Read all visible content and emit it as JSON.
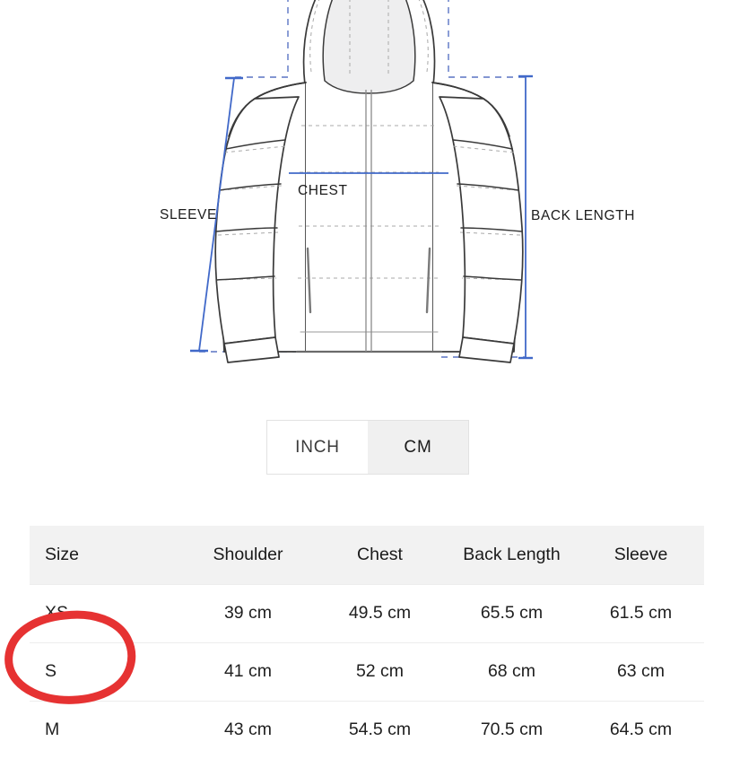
{
  "diagram": {
    "labels": {
      "sleeve": "SLEEVE",
      "chest": "CHEST",
      "back_length": "BACK LENGTH"
    },
    "colors": {
      "measurement_line": "#4169c9",
      "guide_line": "#5a74c4",
      "outline": "#3a3a3a",
      "hood_fill": "#eeeeef"
    }
  },
  "unit_toggle": {
    "options": [
      {
        "label": "INCH",
        "selected": false
      },
      {
        "label": "CM",
        "selected": true
      }
    ]
  },
  "size_table": {
    "columns": [
      "Size",
      "Shoulder",
      "Chest",
      "Back Length",
      "Sleeve"
    ],
    "rows": [
      {
        "size": "XS",
        "shoulder": "39 cm",
        "chest": "49.5 cm",
        "back_length": "65.5 cm",
        "sleeve": "61.5 cm"
      },
      {
        "size": "S",
        "shoulder": "41 cm",
        "chest": "52 cm",
        "back_length": "68 cm",
        "sleeve": "63 cm"
      },
      {
        "size": "M",
        "shoulder": "43 cm",
        "chest": "54.5 cm",
        "back_length": "70.5 cm",
        "sleeve": "64.5 cm"
      }
    ]
  },
  "annotation": {
    "type": "hand-drawn-circle",
    "color": "#e63232",
    "target_row": "S"
  }
}
